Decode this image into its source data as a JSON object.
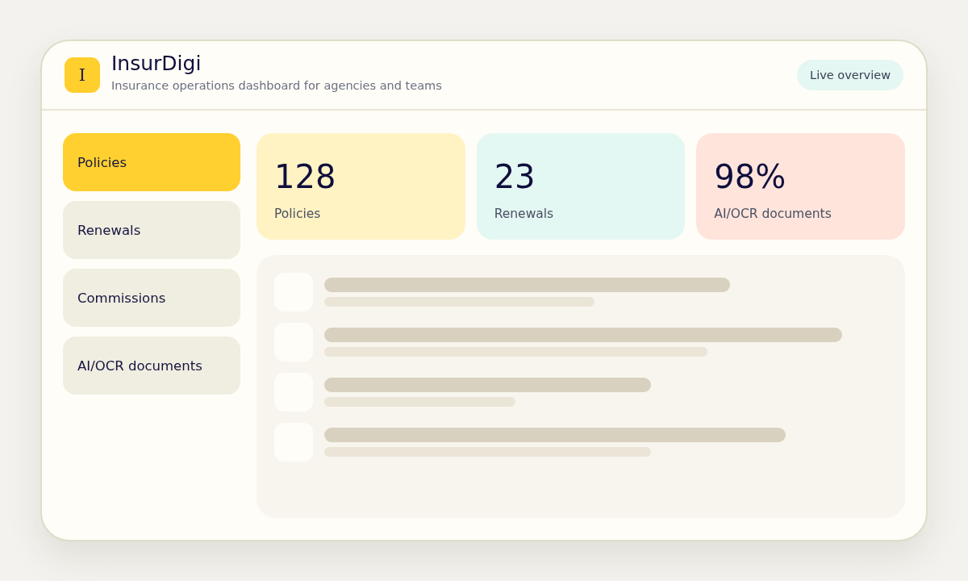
{
  "header": {
    "logo_letter": "I",
    "title": "InsurDigi",
    "subtitle": "Insurance operations dashboard for agencies and teams",
    "badge": "Live overview"
  },
  "sidebar": {
    "items": [
      {
        "label": "Policies",
        "selected": true
      },
      {
        "label": "Renewals",
        "selected": false
      },
      {
        "label": "Commissions",
        "selected": false
      },
      {
        "label": "AI/OCR documents",
        "selected": false
      }
    ]
  },
  "stats": [
    {
      "value": "128",
      "label": "Policies",
      "color": "#fff3c4"
    },
    {
      "value": "23",
      "label": "Renewals",
      "color": "#e4f8f3"
    },
    {
      "value": "98%",
      "label": "AI/OCR documents",
      "color": "#ffe4dc"
    }
  ],
  "content_panel": {
    "loading": true
  }
}
